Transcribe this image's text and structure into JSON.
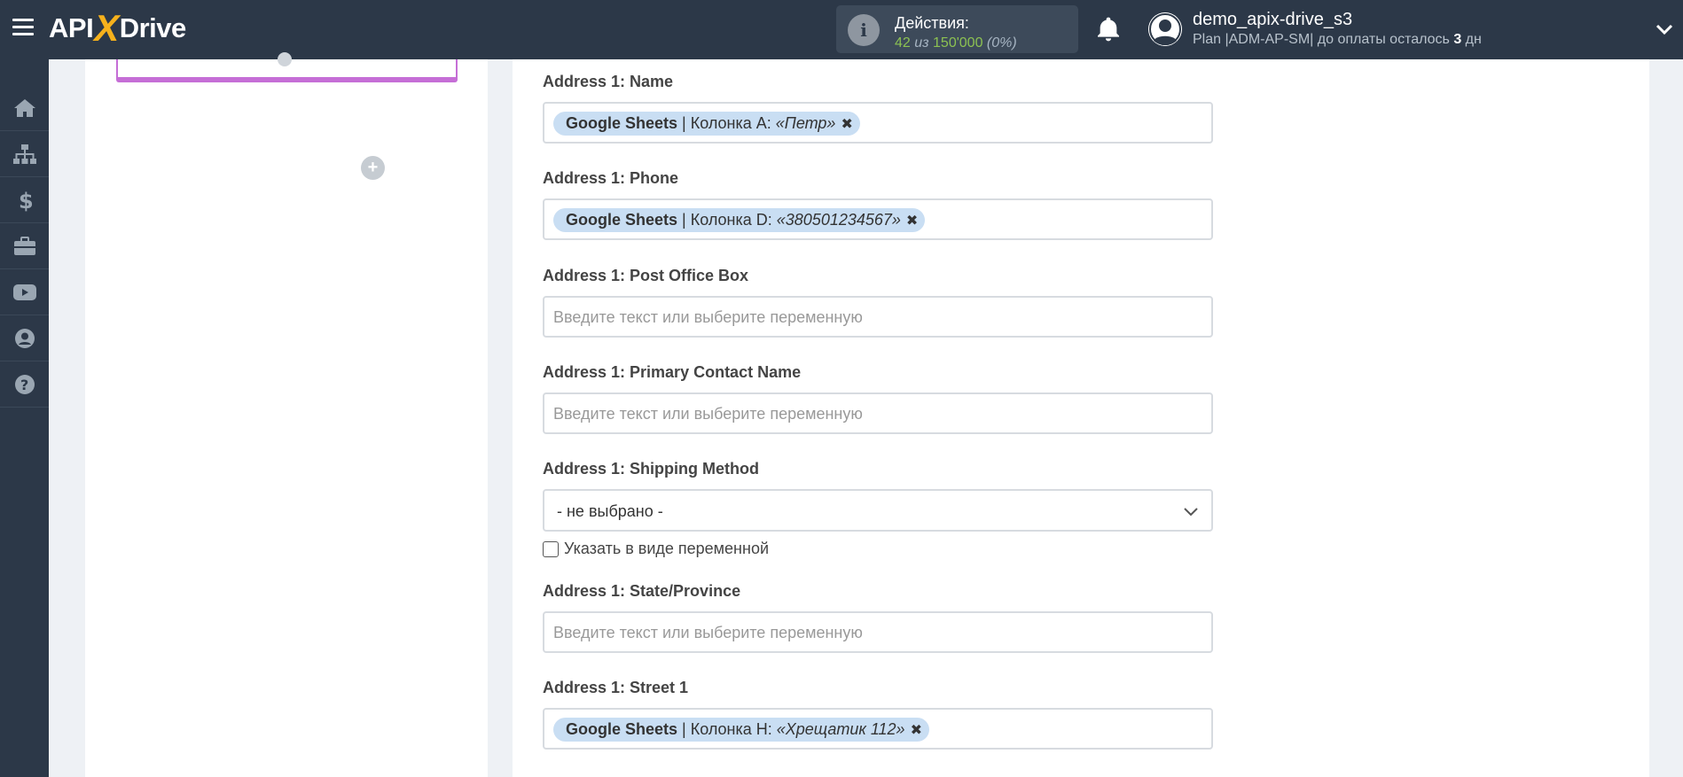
{
  "header": {
    "logo_left": "API",
    "logo_x": "X",
    "logo_right": "Drive",
    "actions_label": "Действия:",
    "actions_used": "42",
    "actions_sep": " из ",
    "actions_total": "150'000",
    "actions_pct": " (0%)",
    "user_name": "demo_apix-drive_s3",
    "plan_prefix": "Plan |ADM-AP-SM| до оплаты осталось ",
    "plan_days": "3",
    "plan_suffix": " дн"
  },
  "sidebar": {
    "items": [
      {
        "icon": "home-icon"
      },
      {
        "icon": "sitemap-icon"
      },
      {
        "icon": "dollar-icon"
      },
      {
        "icon": "briefcase-icon"
      },
      {
        "icon": "youtube-icon"
      },
      {
        "icon": "user-circle-icon"
      },
      {
        "icon": "question-icon"
      }
    ]
  },
  "left_panel": {
    "add_label": "+"
  },
  "fields": {
    "name": {
      "label": "Address 1: Name",
      "tag_source": "Google Sheets",
      "tag_column": "Колонка A:",
      "tag_value": "«Петр»",
      "remove": "✖"
    },
    "phone": {
      "label": "Address 1: Phone",
      "tag_source": "Google Sheets",
      "tag_column": "Колонка D:",
      "tag_value": "«380501234567»",
      "remove": "✖"
    },
    "po_box": {
      "label": "Address 1: Post Office Box",
      "placeholder": "Введите текст или выберите переменную"
    },
    "primary_contact": {
      "label": "Address 1: Primary Contact Name",
      "placeholder": "Введите текст или выберите переменную"
    },
    "shipping": {
      "label": "Address 1: Shipping Method",
      "selected": "- не выбрано -",
      "checkbox_label": "Указать в виде переменной"
    },
    "state": {
      "label": "Address 1: State/Province",
      "placeholder": "Введите текст или выберите переменную"
    },
    "street1": {
      "label": "Address 1: Street 1",
      "tag_source": "Google Sheets",
      "tag_column": "Колонка H:",
      "tag_value": "«Хрещатик 112»",
      "remove": "✖"
    }
  },
  "colors": {
    "topbar": "#2c3848",
    "accent_purple": "#c56ed6",
    "tag_bg": "#c9def3",
    "green": "#8cc152",
    "logo_x": "#f6b11c"
  }
}
